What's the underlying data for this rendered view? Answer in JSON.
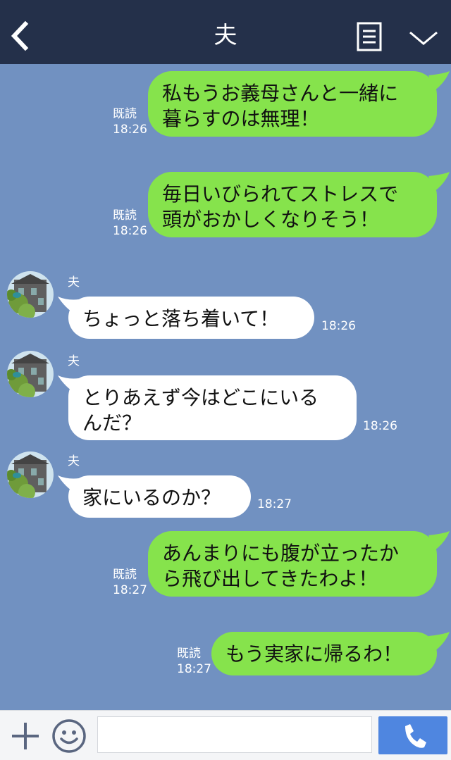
{
  "header": {
    "title": "夫",
    "back_icon": "chevron-left-icon",
    "menu_icon": "document-menu-icon",
    "expand_icon": "chevron-down-icon"
  },
  "messages": [
    {
      "direction": "out",
      "text": "私もうお義母さんと一緒に\n暮らすのは無理！",
      "read": "既読",
      "time": "18:26"
    },
    {
      "direction": "out",
      "text": "毎日いびられてストレスで\n頭がおかしくなりそう！",
      "read": "既読",
      "time": "18:26"
    },
    {
      "direction": "in",
      "sender": "夫",
      "text": "ちょっと落ち着いて！",
      "time": "18:26"
    },
    {
      "direction": "in",
      "sender": "夫",
      "text": "とりあえず今はどこにいる\nんだ？",
      "time": "18:26"
    },
    {
      "direction": "in",
      "sender": "夫",
      "text": "家にいるのか？",
      "time": "18:27"
    },
    {
      "direction": "out",
      "text": "あんまりにも腹が立ったか\nら飛び出してきたわよ！",
      "read": "既読",
      "time": "18:27"
    },
    {
      "direction": "out",
      "text": "もう実家に帰るわ！",
      "read": "既読",
      "time": "18:27"
    }
  ],
  "footer": {
    "input_value": "",
    "plus_icon": "plus-icon",
    "emoji_icon": "smiley-icon",
    "call_icon": "phone-icon"
  },
  "colors": {
    "background": "#7191c1",
    "header": "#24304a",
    "outgoing_bubble": "#86e34c",
    "incoming_bubble": "#ffffff",
    "call_button": "#4f86e0"
  }
}
